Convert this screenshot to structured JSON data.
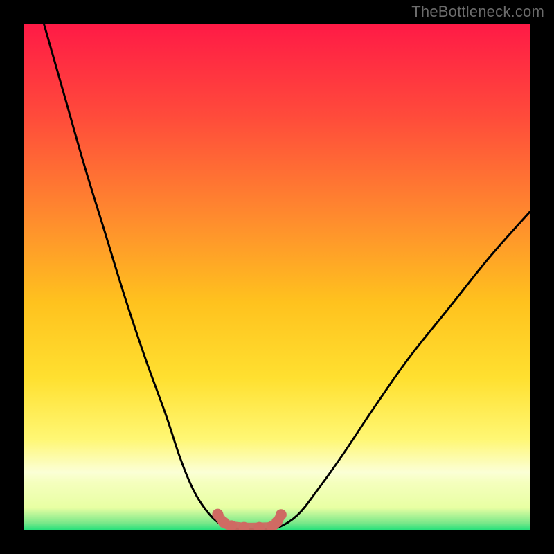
{
  "watermark": "TheBottleneck.com",
  "chart_data": {
    "type": "line",
    "title": "",
    "xlabel": "",
    "ylabel": "",
    "xlim": [
      0,
      100
    ],
    "ylim": [
      0,
      100
    ],
    "series": [
      {
        "name": "curve-left",
        "x": [
          4,
          8,
          12,
          16,
          20,
          24,
          28,
          31,
          33.5,
          36,
          38.5,
          41
        ],
        "y": [
          100,
          86,
          72,
          59,
          46,
          34,
          23,
          14,
          8,
          4,
          1.5,
          0.5
        ]
      },
      {
        "name": "valley-floor",
        "x": [
          41,
          44,
          47,
          50
        ],
        "y": [
          0.5,
          0.3,
          0.3,
          0.5
        ]
      },
      {
        "name": "curve-right",
        "x": [
          50,
          54,
          58,
          63,
          69,
          76,
          84,
          92,
          100
        ],
        "y": [
          0.5,
          3,
          8,
          15,
          24,
          34,
          44,
          54,
          63
        ]
      }
    ],
    "markers": {
      "name": "valley-markers",
      "x": [
        38.3,
        39.5,
        41.0,
        43.5,
        46.5,
        49.0,
        50.0,
        50.8
      ],
      "y": [
        3.2,
        1.6,
        0.9,
        0.6,
        0.6,
        0.8,
        1.7,
        3.1
      ]
    },
    "colors": {
      "gradient_top": "#ff1a46",
      "gradient_mid_upper": "#ff7a2a",
      "gradient_mid": "#ffd400",
      "gradient_mid_lower": "#fff47a",
      "gradient_band": "#f7ffb0",
      "gradient_bottom": "#1fe07a",
      "curve": "#000000",
      "marker": "#cf6a63",
      "background": "#000000"
    }
  }
}
